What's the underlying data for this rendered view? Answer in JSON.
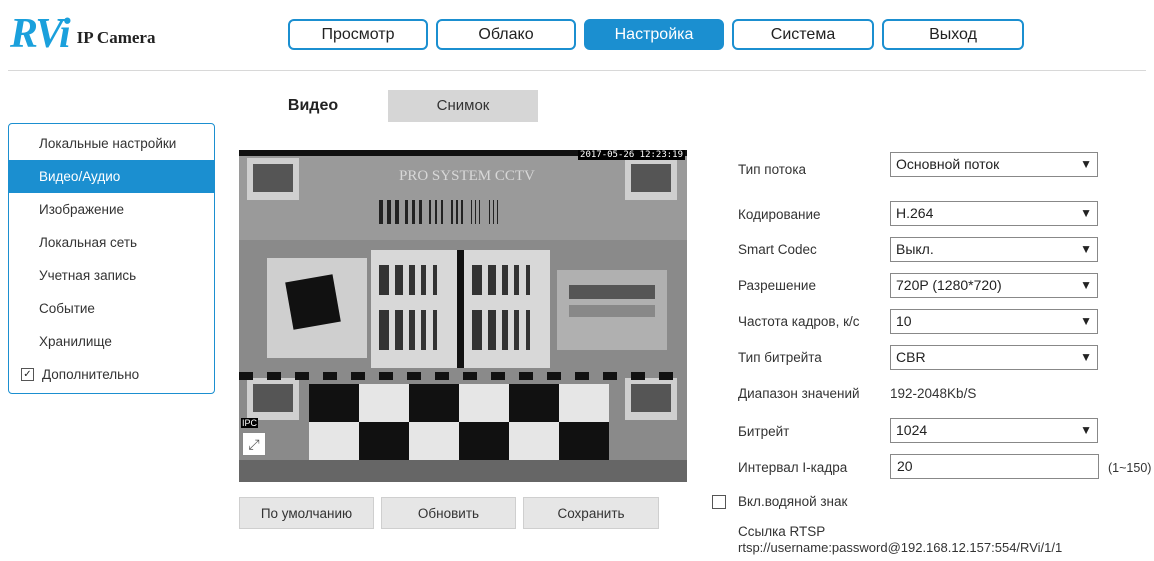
{
  "logo": {
    "mark": "RVi",
    "subtitle": "IP Camera"
  },
  "topnav": [
    {
      "label": "Просмотр",
      "active": false
    },
    {
      "label": "Облако",
      "active": false
    },
    {
      "label": "Настройка",
      "active": true
    },
    {
      "label": "Система",
      "active": false
    },
    {
      "label": "Выход",
      "active": false
    }
  ],
  "sidebar": {
    "items": [
      {
        "label": "Локальные настройки"
      },
      {
        "label": "Видео/Аудио",
        "active": true
      },
      {
        "label": "Изображение"
      },
      {
        "label": "Локальная сеть"
      },
      {
        "label": "Учетная запись"
      },
      {
        "label": "Событие"
      },
      {
        "label": "Хранилище"
      }
    ],
    "advanced": {
      "label": "Дополнительно",
      "checked": true
    }
  },
  "tabs": [
    {
      "label": "Видео",
      "active": true
    },
    {
      "label": "Снимок",
      "active": false
    }
  ],
  "video": {
    "timestamp": "2017-05-26 12:23:19",
    "osd_name": "IPC",
    "brand_text": "PRO SYSTEM CCTV",
    "fullscreen_icon": "fullscreen-icon"
  },
  "buttons": {
    "default": "По умолчанию",
    "refresh": "Обновить",
    "save": "Сохранить"
  },
  "form": {
    "stream_type": {
      "label": "Тип потока",
      "value": "Основной поток"
    },
    "encoding": {
      "label": "Кодирование",
      "value": "H.264"
    },
    "smart_codec": {
      "label": "Smart Codec",
      "value": "Выкл."
    },
    "resolution": {
      "label": "Разрешение",
      "value": "720P (1280*720)"
    },
    "framerate": {
      "label": "Частота кадров, к/с",
      "value": "10"
    },
    "bitrate_type": {
      "label": "Тип битрейта",
      "value": "CBR"
    },
    "range": {
      "label": "Диапазон значений",
      "value": "192-2048Kb/S"
    },
    "bitrate": {
      "label": "Битрейт",
      "value": "1024"
    },
    "iframe": {
      "label": "Интервал I-кадра",
      "value": "20",
      "hint": "(1~150)"
    },
    "watermark": {
      "label": "Вкл.водяной знак",
      "checked": false
    },
    "rtsp": {
      "label": "Ссылка RTSP",
      "value": "rtsp://username:password@192.168.12.157:554/RVi/1/1"
    }
  },
  "colors": {
    "accent": "#1b8fd0",
    "logo": "#1aa0dc"
  }
}
